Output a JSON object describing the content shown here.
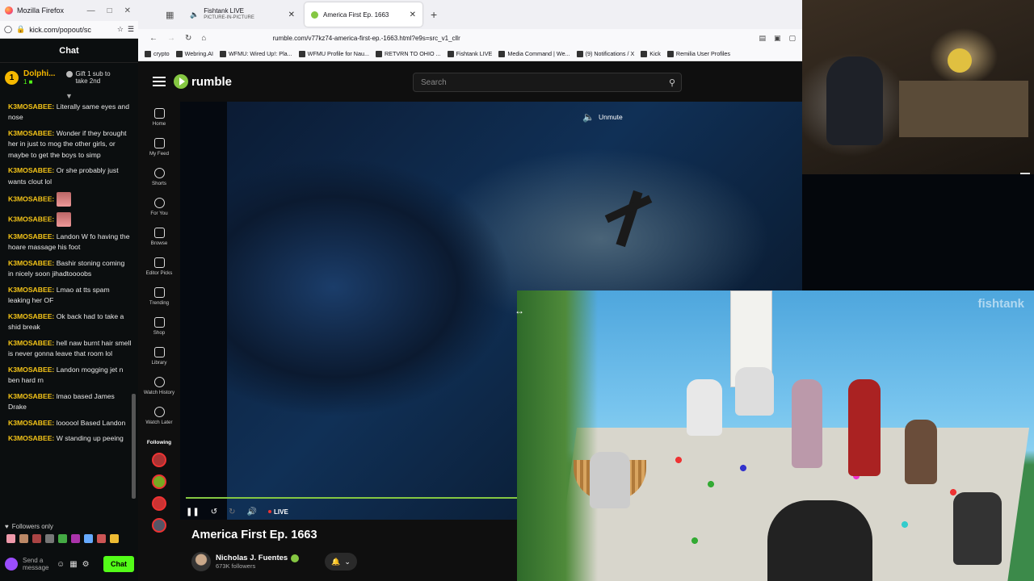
{
  "popout": {
    "window_title": "Mozilla Firefox",
    "url": "kick.com/popout/sc",
    "chat_header": "Chat",
    "pinned": {
      "badge": "1",
      "name": "Dolphi...",
      "sub_count": "1",
      "gift_text": "Gift 1 sub to take 2nd"
    },
    "messages": [
      {
        "user": "K3MOSABEE:",
        "text": "Literally same eyes and nose"
      },
      {
        "user": "K3MOSABEE:",
        "text": "Wonder if they brought her in just to mog the other girls, or maybe to get the boys to simp"
      },
      {
        "user": "K3MOSABEE:",
        "text": "Or she probably just wants clout lol"
      },
      {
        "user": "K3MOSABEE:",
        "text": "",
        "emote": true
      },
      {
        "user": "K3MOSABEE:",
        "text": "",
        "emote": true
      },
      {
        "user": "K3MOSABEE:",
        "text": "Landon W fo having the hoare massage his foot"
      },
      {
        "user": "K3MOSABEE:",
        "text": "Bashir stoning coming in nicely soon jihadtoooobs"
      },
      {
        "user": "K3MOSABEE:",
        "text": "Lmao at tts spam leaking her OF"
      },
      {
        "user": "K3MOSABEE:",
        "text": "Ok back had to take a shid break"
      },
      {
        "user": "K3MOSABEE:",
        "text": "hell naw burnt hair smell is never gonna leave that room lol"
      },
      {
        "user": "K3MOSABEE:",
        "text": "Landon mogging jet n ben hard rn"
      },
      {
        "user": "K3MOSABEE:",
        "text": "lmao based James Drake"
      },
      {
        "user": "K3MOSABEE:",
        "text": "loooool Based Landon"
      },
      {
        "user": "K3MOSABEE:",
        "text": "W standing up peeing"
      }
    ],
    "followers_only": "Followers only",
    "send_placeholder": "Send a message",
    "chat_button": "Chat"
  },
  "browser": {
    "tabs": [
      {
        "title": "Fishtank LIVE",
        "subtitle": "PICTURE-IN-PICTURE"
      },
      {
        "title": "America First Ep. 1663"
      }
    ],
    "url": "rumble.com/v77kz74-america-first-ep.-1663.html?e9s=src_v1_cllr",
    "bookmarks": [
      "crypto",
      "Webring.AI",
      "WFMU: Wired Up!: Pla...",
      "WFMU Profile for Nau...",
      "RETVRN TO OHIO ...",
      "Fishtank LIVE",
      "Media Command | We...",
      "(9) Notifications / X",
      "Kick",
      "Remilia User Profiles"
    ]
  },
  "rumble": {
    "logo_text": "rumble",
    "search_placeholder": "Search",
    "nav": [
      {
        "label": "Home"
      },
      {
        "label": "My Feed"
      },
      {
        "label": "Shorts"
      },
      {
        "label": "For You"
      },
      {
        "label": "Browse"
      },
      {
        "label": "Editor Picks"
      },
      {
        "label": "Trending"
      },
      {
        "label": "Shop"
      },
      {
        "label": "Library"
      },
      {
        "label": "Watch History"
      },
      {
        "label": "Watch Later"
      }
    ],
    "following_label": "Following",
    "unmute_label": "Unmute",
    "live_label": "LIVE",
    "video_title": "America First Ep. 1663",
    "channel_name": "Nicholas J. Fuentes",
    "followers": "673K followers"
  },
  "pip": {
    "watermark": "fishtank"
  },
  "colors": {
    "rumble_green": "#85c742",
    "kick_green": "#53fc18",
    "username_yellow": "#f5c518"
  }
}
